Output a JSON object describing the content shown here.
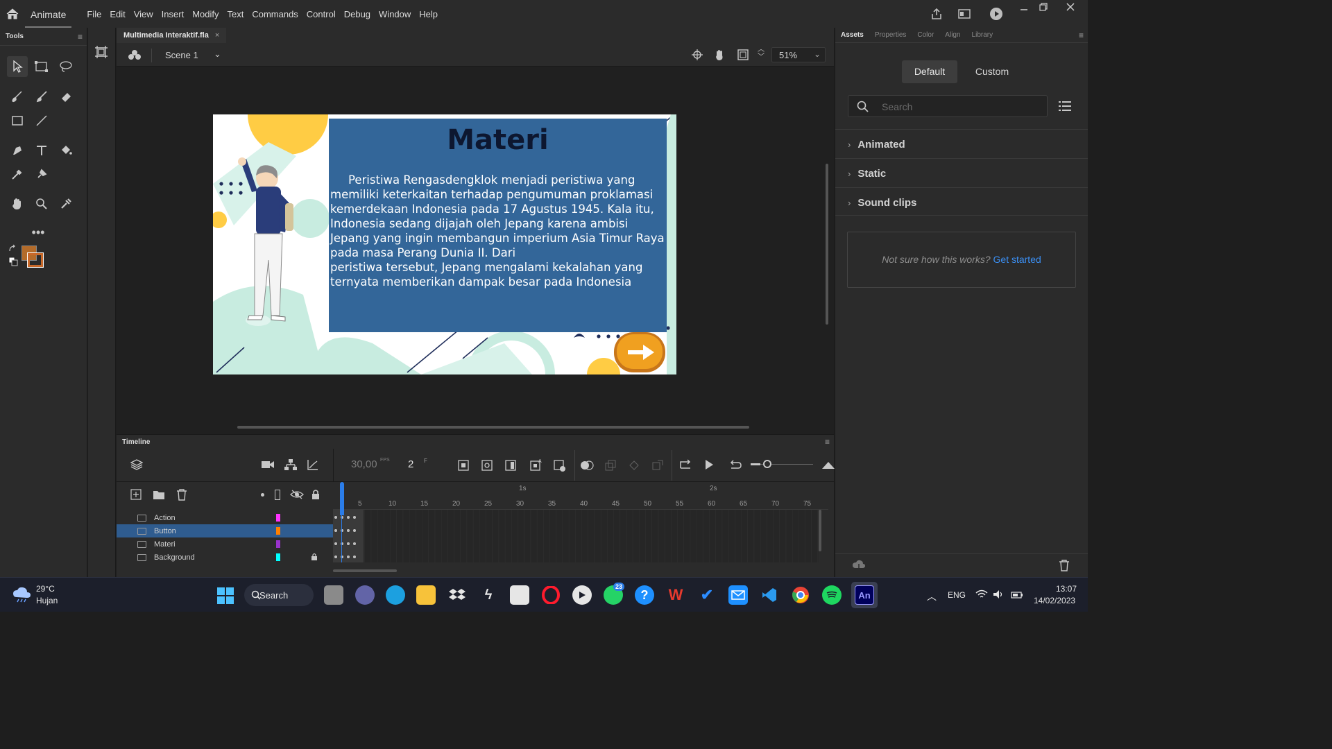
{
  "app": {
    "name": "Animate",
    "menu": [
      "File",
      "Edit",
      "View",
      "Insert",
      "Modify",
      "Text",
      "Commands",
      "Control",
      "Debug",
      "Window",
      "Help"
    ]
  },
  "tools_panel": {
    "title": "Tools"
  },
  "document": {
    "tab_title": "Multimedia Interaktif.fla",
    "scene": "Scene 1",
    "zoom": "51%"
  },
  "stage": {
    "title": "Materi",
    "paragraph": "Peristiwa Rengasdengklok menjadi peristiwa yang memiliki keterkaitan terhadap pengumuman proklamasi kemerdekaan Indonesia pada 17 Agustus 1945. Kala itu, Indonesia sedang dijajah oleh Jepang karena ambisi Jepang yang ingin membangun imperium Asia Timur Raya pada masa Perang Dunia II. Dari",
    "paragraph2": "peristiwa tersebut, Jepang mengalami kekalahan yang ternyata memberikan dampak besar pada Indonesia"
  },
  "right_panel": {
    "tabs": [
      "Assets",
      "Properties",
      "Color",
      "Align",
      "Library"
    ],
    "active_tab": "Assets",
    "segments": [
      "Default",
      "Custom"
    ],
    "search_placeholder": "Search",
    "categories": [
      "Animated",
      "Static",
      "Sound clips"
    ],
    "hint_text": "Not sure how this works?",
    "hint_link": "Get started"
  },
  "timeline": {
    "title": "Timeline",
    "fps": "30,00",
    "fps_unit": "FPS",
    "frame": "2",
    "frame_unit": "F",
    "ruler_marks": [
      "5",
      "10",
      "15",
      "20",
      "25",
      "30",
      "35",
      "40",
      "45",
      "50",
      "55",
      "60",
      "65",
      "70",
      "75"
    ],
    "second_marks": [
      "1s",
      "2s"
    ],
    "layers": [
      {
        "name": "Action",
        "color": "#ff33ff"
      },
      {
        "name": "Button",
        "color": "#ff8000"
      },
      {
        "name": "Materi",
        "color": "#9933cc"
      },
      {
        "name": "Background",
        "color": "#00ffff"
      }
    ],
    "selected_layer": "Button"
  },
  "taskbar": {
    "weather_temp": "29°C",
    "weather_desc": "Hujan",
    "search_label": "Search",
    "whatsapp_badge": "23",
    "lang": "ENG",
    "time": "13:07",
    "date": "14/02/2023",
    "active_app": "An"
  },
  "colors": {
    "stroke_color": "#b36b2a",
    "fill_color": "#c8692a",
    "accent": "#2f5c8f"
  }
}
